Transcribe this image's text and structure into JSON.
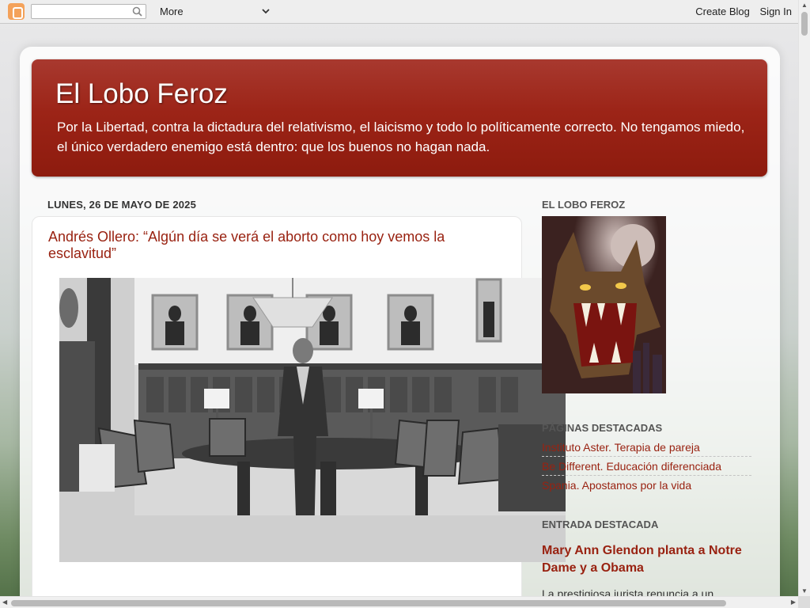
{
  "navbar": {
    "search_placeholder": "",
    "more_label": "More",
    "create_blog": "Create Blog",
    "sign_in": "Sign In"
  },
  "header": {
    "title": "El Lobo Feroz",
    "description": "Por la Libertad, contra la dictadura del relativismo, el laicismo y todo lo políticamente correcto. No tengamos miedo, el único verdadero enemigo está dentro: que los buenos no hagan nada."
  },
  "main": {
    "date_header": "LUNES, 26 DE MAYO DE 2025",
    "post_title": "Andrés Ollero: “Algún día se verá el aborto como hoy vemos la esclavitud”"
  },
  "sidebar": {
    "profile_heading": "EL LOBO FEROZ",
    "pages_heading": "PÁGINAS DESTACADAS",
    "pages": [
      "Instituto Aster. Terapia de pareja",
      "Be Different. Educación diferenciada",
      "Spania. Apostamos por la vida"
    ],
    "featured_heading": "ENTRADA DESTACADA",
    "featured_title": "Mary Ann Glendon planta a Notre Dame y a Obama",
    "featured_snippet": "La prestigiosa jurista renuncia a un"
  },
  "colors": {
    "header_bg": "#9c2417",
    "link": "#992211",
    "blogger_orange": "#f4a25a"
  },
  "icons": [
    "blogger-logo-icon",
    "search-icon",
    "chevron-down-icon"
  ]
}
